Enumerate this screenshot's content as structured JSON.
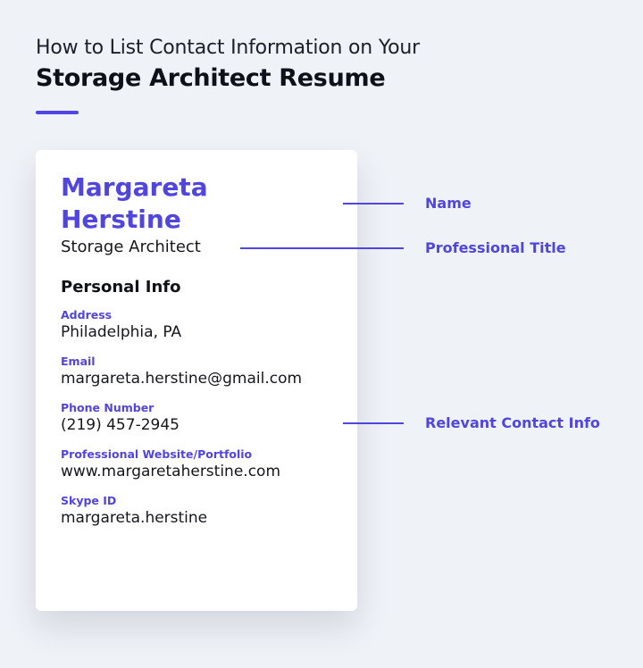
{
  "header": {
    "line1": "How to List Contact Information on Your",
    "line2": "Storage Architect Resume"
  },
  "resume": {
    "name": "Margareta Herstine",
    "title": "Storage Architect",
    "section_heading": "Personal Info",
    "fields": [
      {
        "label": "Address",
        "value": "Philadelphia, PA"
      },
      {
        "label": "Email",
        "value": "margareta.herstine@gmail.com"
      },
      {
        "label": "Phone Number",
        "value": "(219) 457-2945"
      },
      {
        "label": "Professional Website/Portfolio",
        "value": "www.margaretaherstine.com"
      },
      {
        "label": "Skype ID",
        "value": "margareta.herstine"
      }
    ]
  },
  "annotations": {
    "name": "Name",
    "professional_title": "Professional Title",
    "contact_info": "Relevant Contact Info"
  },
  "colors": {
    "accent": "#5145e0",
    "background": "#eff2f7",
    "card": "#ffffff"
  }
}
